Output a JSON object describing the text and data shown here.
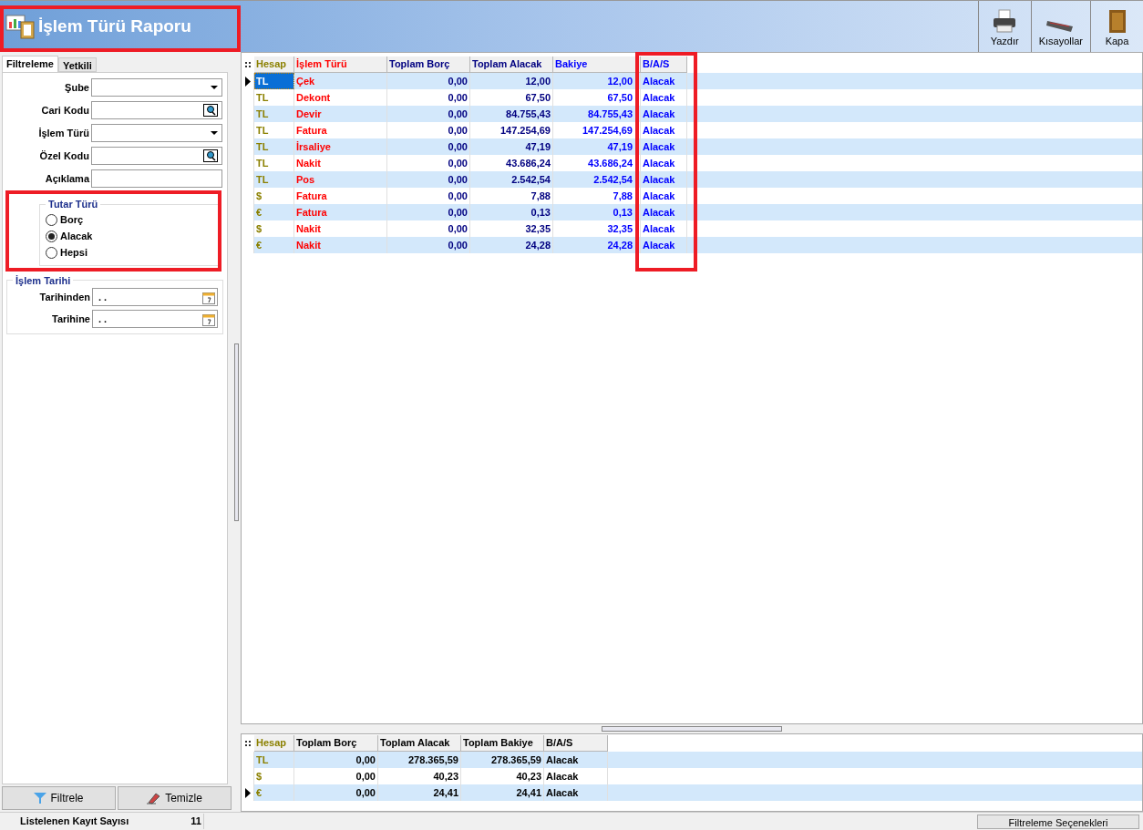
{
  "window": {
    "title": "İşlem Türü Raporu"
  },
  "toolbar": [
    {
      "label": "Yazdır",
      "kind": "printer"
    },
    {
      "label": "Kısayollar",
      "kind": "keyboard"
    },
    {
      "label": "Kapa",
      "kind": "door"
    }
  ],
  "tabs": [
    {
      "label": "Filtreleme",
      "selected": true
    },
    {
      "label": "Yetkili",
      "selected": false
    }
  ],
  "filters": [
    {
      "label": "Şube",
      "kind": "dropdown"
    },
    {
      "label": "Cari Kodu",
      "kind": "lookup"
    },
    {
      "label": "İşlem Türü",
      "kind": "dropdown"
    },
    {
      "label": "Özel Kodu",
      "kind": "lookup"
    },
    {
      "label": "Açıklama",
      "kind": "text"
    }
  ],
  "amount_type": {
    "title": "Tutar Türü",
    "options": [
      {
        "label": "Borç",
        "selected": false
      },
      {
        "label": "Alacak",
        "selected": true
      },
      {
        "label": "Hepsi",
        "selected": false
      }
    ]
  },
  "date_range": {
    "title": "İşlem Tarihi",
    "fields": [
      {
        "label": "Tarihinden",
        "value": ". ."
      },
      {
        "label": "Tarihine",
        "value": ". ."
      }
    ]
  },
  "buttons": [
    {
      "label": "Filtrele",
      "kind": "filter"
    },
    {
      "label": "Temizle",
      "kind": "eraser"
    }
  ],
  "table": {
    "columns": [
      {
        "label": "Hesap",
        "color": "#8b8000"
      },
      {
        "label": "İşlem Türü",
        "color": "#ff0000"
      },
      {
        "label": "Toplam Borç",
        "color": "#000080"
      },
      {
        "label": "Toplam Alacak",
        "color": "#000080"
      },
      {
        "label": "Bakiye",
        "color": "#0000ff"
      },
      {
        "label": "B/A/S",
        "color": "#0000ff"
      }
    ],
    "rows": [
      {
        "selected": true,
        "cells": [
          "TL",
          "Çek",
          "0,00",
          "12,00",
          "12,00",
          "Alacak"
        ]
      },
      {
        "selected": false,
        "cells": [
          "TL",
          "Dekont",
          "0,00",
          "67,50",
          "67,50",
          "Alacak"
        ]
      },
      {
        "selected": false,
        "cells": [
          "TL",
          "Devir",
          "0,00",
          "84.755,43",
          "84.755,43",
          "Alacak"
        ]
      },
      {
        "selected": false,
        "cells": [
          "TL",
          "Fatura",
          "0,00",
          "147.254,69",
          "147.254,69",
          "Alacak"
        ]
      },
      {
        "selected": false,
        "cells": [
          "TL",
          "İrsaliye",
          "0,00",
          "47,19",
          "47,19",
          "Alacak"
        ]
      },
      {
        "selected": false,
        "cells": [
          "TL",
          "Nakit",
          "0,00",
          "43.686,24",
          "43.686,24",
          "Alacak"
        ]
      },
      {
        "selected": false,
        "cells": [
          "TL",
          "Pos",
          "0,00",
          "2.542,54",
          "2.542,54",
          "Alacak"
        ]
      },
      {
        "selected": false,
        "cells": [
          "$",
          "Fatura",
          "0,00",
          "7,88",
          "7,88",
          "Alacak"
        ]
      },
      {
        "selected": false,
        "cells": [
          "€",
          "Fatura",
          "0,00",
          "0,13",
          "0,13",
          "Alacak"
        ]
      },
      {
        "selected": false,
        "cells": [
          "$",
          "Nakit",
          "0,00",
          "32,35",
          "32,35",
          "Alacak"
        ]
      },
      {
        "selected": false,
        "cells": [
          "€",
          "Nakit",
          "0,00",
          "24,28",
          "24,28",
          "Alacak"
        ]
      }
    ]
  },
  "summary": {
    "columns": [
      {
        "label": "Hesap",
        "color": "#8b8000"
      },
      {
        "label": "Toplam Borç",
        "color": "#000000"
      },
      {
        "label": "Toplam Alacak",
        "color": "#000000"
      },
      {
        "label": "Toplam Bakiye",
        "color": "#000000"
      },
      {
        "label": "B/A/S",
        "color": "#000000"
      }
    ],
    "rows": [
      {
        "selected": false,
        "cells": [
          "TL",
          "0,00",
          "278.365,59",
          "278.365,59",
          "Alacak"
        ]
      },
      {
        "selected": false,
        "cells": [
          "$",
          "0,00",
          "40,23",
          "40,23",
          "Alacak"
        ]
      },
      {
        "selected": true,
        "cells": [
          "€",
          "0,00",
          "24,41",
          "24,41",
          "Alacak"
        ]
      }
    ]
  },
  "status_bar": {
    "label": "Listelenen Kayıt Sayısı",
    "count": "11",
    "button": "Filtreleme Seçenekleri"
  }
}
